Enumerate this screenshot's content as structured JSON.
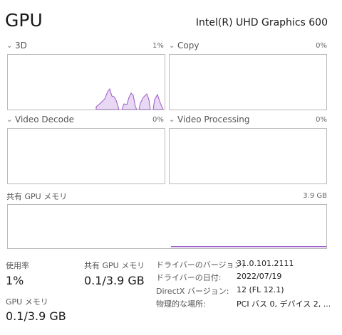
{
  "header": {
    "title": "GPU",
    "adapter": "Intel(R) UHD Graphics 600"
  },
  "engines": [
    {
      "name": "3D",
      "percent": "1%"
    },
    {
      "name": "Copy",
      "percent": "0%"
    },
    {
      "name": "Video Decode",
      "percent": "0%"
    },
    {
      "name": "Video Processing",
      "percent": "0%"
    }
  ],
  "shared_memory": {
    "label": "共有 GPU メモリ",
    "max": "3.9 GB"
  },
  "stats": {
    "utilization_label": "使用率",
    "utilization_value": "1%",
    "shared_label": "共有 GPU メモリ",
    "shared_value": "0.1/3.9 GB",
    "gpu_mem_label": "GPU メモリ",
    "gpu_mem_value": "0.1/3.9 GB"
  },
  "info": [
    {
      "key": "ドライバーのバージョン:",
      "value": "31.0.101.2111"
    },
    {
      "key": "ドライバーの日付:",
      "value": "2022/07/19"
    },
    {
      "key": "DirectX バージョン:",
      "value": "12 (FL 12.1)"
    },
    {
      "key": "物理的な場所:",
      "value": "PCI バス 0, デバイス 2, ..."
    }
  ],
  "colors": {
    "graph_line": "#9a58c6",
    "graph_fill": "#e9d8f4",
    "border": "#b9b9b9"
  }
}
